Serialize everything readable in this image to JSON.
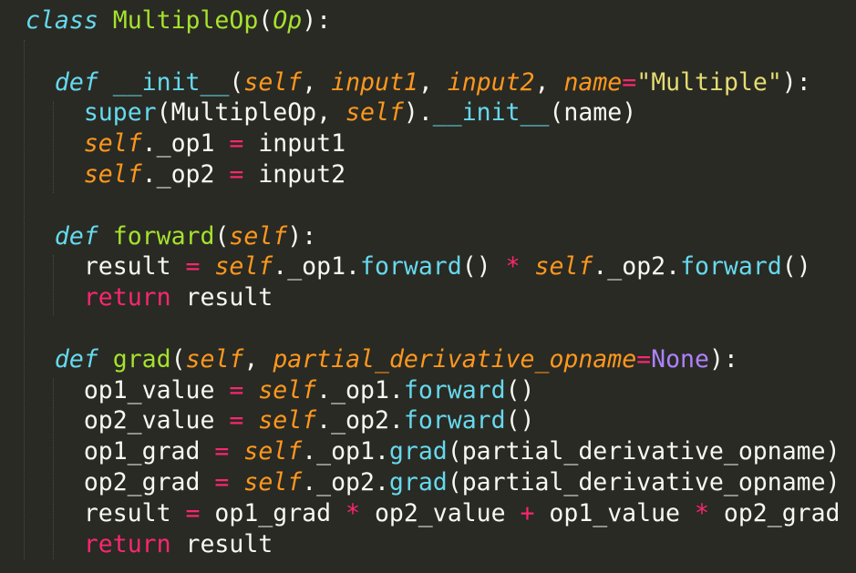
{
  "editor": {
    "background": "#292a23",
    "indent_guide_color": "rgba(248,248,242,0.16)",
    "palette": {
      "w": {
        "color": "#F8F8F2",
        "italic": false
      },
      "k": {
        "color": "#66D9EF",
        "italic": true
      },
      "fn": {
        "color": "#A6E22E",
        "italic": false
      },
      "cls": {
        "color": "#A6E22E",
        "italic": true
      },
      "prm": {
        "color": "#FD971F",
        "italic": true
      },
      "op": {
        "color": "#F92672",
        "italic": false
      },
      "str": {
        "color": "#E6DB74",
        "italic": false
      },
      "const": {
        "color": "#AE81FF",
        "italic": false
      },
      "call": {
        "color": "#66D9EF",
        "italic": false
      }
    },
    "lines": [
      [
        [
          "class",
          "k"
        ],
        [
          " ",
          "w"
        ],
        [
          "MultipleOp",
          "fn"
        ],
        [
          "(",
          "w"
        ],
        [
          "Op",
          "cls"
        ],
        [
          "):",
          "w"
        ]
      ],
      [],
      [
        [
          "  ",
          "w"
        ],
        [
          "def",
          "k"
        ],
        [
          " ",
          "w"
        ],
        [
          "__init__",
          "call"
        ],
        [
          "(",
          "w"
        ],
        [
          "self",
          "prm"
        ],
        [
          ", ",
          "w"
        ],
        [
          "input1",
          "prm"
        ],
        [
          ", ",
          "w"
        ],
        [
          "input2",
          "prm"
        ],
        [
          ", ",
          "w"
        ],
        [
          "name",
          "prm"
        ],
        [
          "=",
          "op"
        ],
        [
          "\"Multiple\"",
          "str"
        ],
        [
          "):",
          "w"
        ]
      ],
      [
        [
          "    ",
          "w"
        ],
        [
          "super",
          "call"
        ],
        [
          "(MultipleOp, ",
          "w"
        ],
        [
          "self",
          "prm"
        ],
        [
          ").",
          "w"
        ],
        [
          "__init__",
          "call"
        ],
        [
          "(name)",
          "w"
        ]
      ],
      [
        [
          "    ",
          "w"
        ],
        [
          "self",
          "prm"
        ],
        [
          "._op1 ",
          "w"
        ],
        [
          "=",
          "op"
        ],
        [
          " input1",
          "w"
        ]
      ],
      [
        [
          "    ",
          "w"
        ],
        [
          "self",
          "prm"
        ],
        [
          "._op2 ",
          "w"
        ],
        [
          "=",
          "op"
        ],
        [
          " input2",
          "w"
        ]
      ],
      [],
      [
        [
          "  ",
          "w"
        ],
        [
          "def",
          "k"
        ],
        [
          " ",
          "w"
        ],
        [
          "forward",
          "fn"
        ],
        [
          "(",
          "w"
        ],
        [
          "self",
          "prm"
        ],
        [
          "):",
          "w"
        ]
      ],
      [
        [
          "    result ",
          "w"
        ],
        [
          "=",
          "op"
        ],
        [
          " ",
          "w"
        ],
        [
          "self",
          "prm"
        ],
        [
          "._op1.",
          "w"
        ],
        [
          "forward",
          "call"
        ],
        [
          "() ",
          "w"
        ],
        [
          "*",
          "op"
        ],
        [
          " ",
          "w"
        ],
        [
          "self",
          "prm"
        ],
        [
          "._op2.",
          "w"
        ],
        [
          "forward",
          "call"
        ],
        [
          "()",
          "w"
        ]
      ],
      [
        [
          "    ",
          "w"
        ],
        [
          "return",
          "op"
        ],
        [
          " result",
          "w"
        ]
      ],
      [],
      [
        [
          "  ",
          "w"
        ],
        [
          "def",
          "k"
        ],
        [
          " ",
          "w"
        ],
        [
          "grad",
          "fn"
        ],
        [
          "(",
          "w"
        ],
        [
          "self",
          "prm"
        ],
        [
          ", ",
          "w"
        ],
        [
          "partial_derivative_opname",
          "prm"
        ],
        [
          "=",
          "op"
        ],
        [
          "None",
          "const"
        ],
        [
          "):",
          "w"
        ]
      ],
      [
        [
          "    op1_value ",
          "w"
        ],
        [
          "=",
          "op"
        ],
        [
          " ",
          "w"
        ],
        [
          "self",
          "prm"
        ],
        [
          "._op1.",
          "w"
        ],
        [
          "forward",
          "call"
        ],
        [
          "()",
          "w"
        ]
      ],
      [
        [
          "    op2_value ",
          "w"
        ],
        [
          "=",
          "op"
        ],
        [
          " ",
          "w"
        ],
        [
          "self",
          "prm"
        ],
        [
          "._op2.",
          "w"
        ],
        [
          "forward",
          "call"
        ],
        [
          "()",
          "w"
        ]
      ],
      [
        [
          "    op1_grad ",
          "w"
        ],
        [
          "=",
          "op"
        ],
        [
          " ",
          "w"
        ],
        [
          "self",
          "prm"
        ],
        [
          "._op1.",
          "w"
        ],
        [
          "grad",
          "call"
        ],
        [
          "(partial_derivative_opname)",
          "w"
        ]
      ],
      [
        [
          "    op2_grad ",
          "w"
        ],
        [
          "=",
          "op"
        ],
        [
          " ",
          "w"
        ],
        [
          "self",
          "prm"
        ],
        [
          "._op2.",
          "w"
        ],
        [
          "grad",
          "call"
        ],
        [
          "(partial_derivative_opname)",
          "w"
        ]
      ],
      [
        [
          "    result ",
          "w"
        ],
        [
          "=",
          "op"
        ],
        [
          " op1_grad ",
          "w"
        ],
        [
          "*",
          "op"
        ],
        [
          " op2_value ",
          "w"
        ],
        [
          "+",
          "op"
        ],
        [
          " op1_value ",
          "w"
        ],
        [
          "*",
          "op"
        ],
        [
          " op2_grad",
          "w"
        ]
      ],
      [
        [
          "    ",
          "w"
        ],
        [
          "return",
          "op"
        ],
        [
          " result",
          "w"
        ]
      ]
    ]
  }
}
